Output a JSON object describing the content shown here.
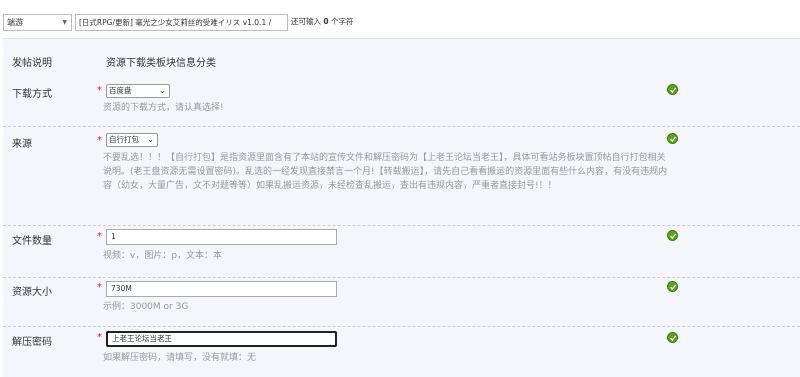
{
  "topbar": {
    "category": "端游",
    "title_value": "[日式RPG/更新] 毫光之少女艾莉丝的受难イリス v1.0.1 /",
    "hint_prefix": "还可输入",
    "hint_count": "0",
    "hint_suffix": "个字符"
  },
  "header": {
    "left": "发帖说明",
    "right": "资源下载类板块信息分类"
  },
  "rows": {
    "download": {
      "label": "下载方式",
      "required": "*",
      "selected": "百度盘",
      "desc": "资源的下载方式，请认真选择!"
    },
    "source": {
      "label": "来源",
      "required": "*",
      "selected": "自行打包",
      "desc": "不要乱选！！！【自行打包】是指资源里面含有了本站的宣传文件和解压密码为【上老王论坛当老王】，具体可看站务板块置顶帖自行打包相关说明。(老王盘资源无需设置密码)。乱选的一经发现直接禁言一个月!【转载搬运】，请先自己看看搬运的资源里面有些什么内容，有没有违规内容（幼女，大量广告，文不对题等等）如果乱搬运资源，未经检查乱搬运，查出有违规内容，严重者直接封号!！！"
    },
    "file_count": {
      "label": "文件数量",
      "required": "*",
      "value": "1",
      "desc": "视频：v，图片：p，文本：本"
    },
    "size": {
      "label": "资源大小",
      "required": "*",
      "value": "730M",
      "desc": "示例：3000M or 3G"
    },
    "password": {
      "label": "解压密码",
      "required": "*",
      "value": "上老王论坛当老王",
      "desc": "如果解压密码，请填写，没有就填：无"
    }
  },
  "colors": {
    "panel_bg": "#f4f6fb",
    "required": "#e02020",
    "ok_icon": "#5aa31a",
    "desc_text": "#999999"
  },
  "icons": {
    "ok": "check-circle-icon",
    "dropdown": "chevron-down-icon"
  }
}
